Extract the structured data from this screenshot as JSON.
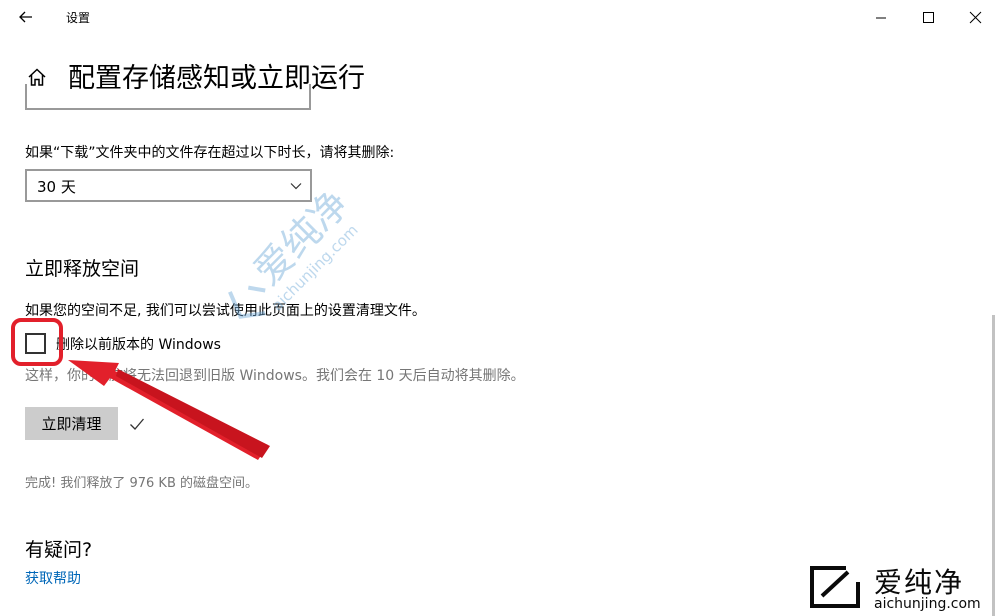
{
  "window": {
    "title": "设置"
  },
  "page": {
    "title": "配置存储感知或立即运行"
  },
  "downloads": {
    "label": "如果“下载”文件夹中的文件存在超过以下时长，请将其删除:",
    "selected": "30 天"
  },
  "free_space": {
    "title": "立即释放空间",
    "description": "如果您的空间不足, 我们可以尝试使用此页面上的设置清理文件。",
    "checkbox_label": "删除以前版本的 Windows",
    "checkbox_checked": false,
    "checkbox_description": "这样，你的电脑将无法回退到旧版 Windows。我们会在 10 天后自动将其删除。",
    "clean_button": "立即清理",
    "result": "完成! 我们释放了 976 KB 的磁盘空间。"
  },
  "help": {
    "title": "有疑问?",
    "link": "获取帮助"
  },
  "watermark": {
    "cn": "爱纯净",
    "en": "aichunjing.com"
  },
  "colors": {
    "link": "#0067b8",
    "annotation": "#e2202b",
    "button_bg": "#cccccc",
    "secondary_text": "#767676"
  }
}
